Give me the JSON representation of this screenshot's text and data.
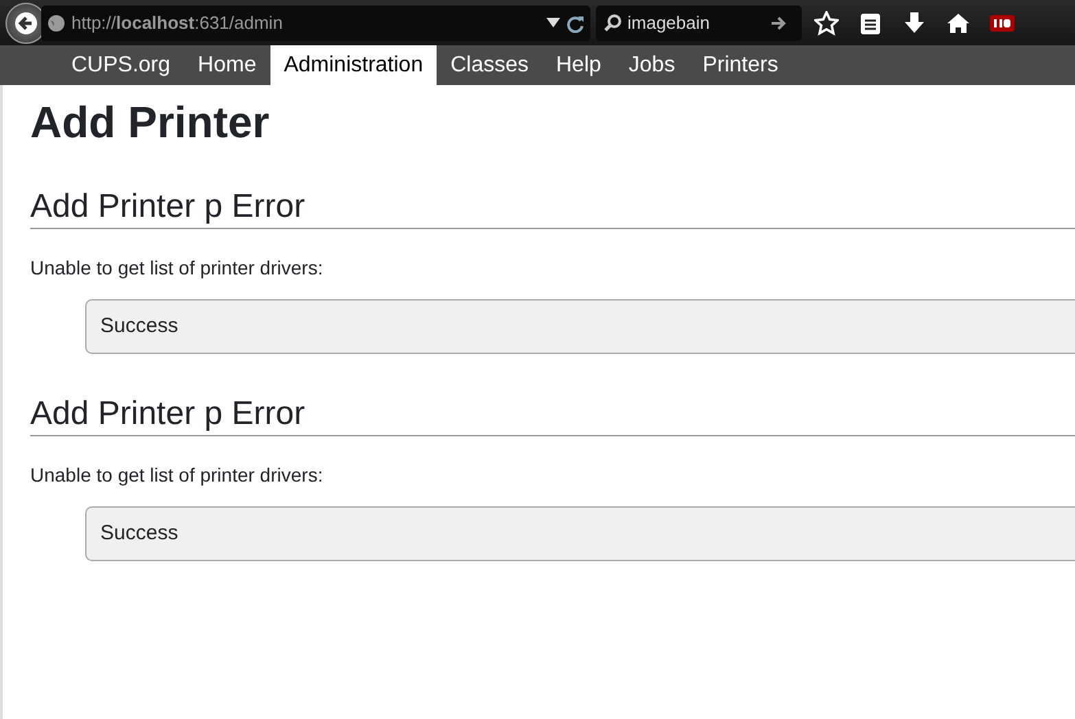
{
  "browser": {
    "url": "http://**localhost**:631/admin",
    "search": {
      "value": "imagebain"
    }
  },
  "nav": [
    {
      "label": "CUPS.org",
      "selected": false
    },
    {
      "label": "Home",
      "selected": false
    },
    {
      "label": "Administration",
      "selected": true
    },
    {
      "label": "Classes",
      "selected": false
    },
    {
      "label": "Help",
      "selected": false
    },
    {
      "label": "Jobs",
      "selected": false
    },
    {
      "label": "Printers",
      "selected": false
    }
  ],
  "title": "Add Printer",
  "sections": [
    {
      "heading": "Add Printer p Error",
      "message": "Unable to get list of printer drivers:",
      "detail": "Success"
    },
    {
      "heading": "Add Printer p Error",
      "message": "Unable to get list of printer drivers:",
      "detail": "Success"
    }
  ]
}
